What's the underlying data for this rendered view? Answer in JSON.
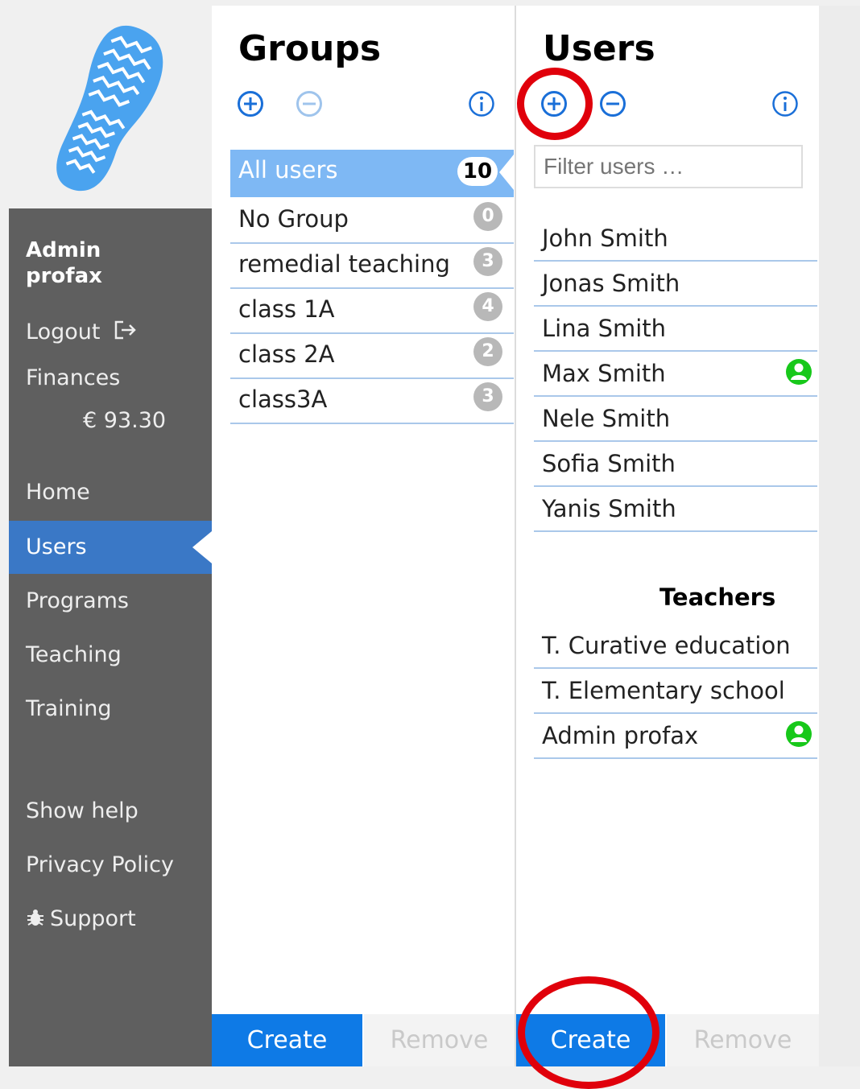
{
  "sidebar": {
    "account": {
      "line1": "Admin",
      "line2": "profax"
    },
    "logout": "Logout",
    "finances": "Finances",
    "balance": "€ 93.30",
    "nav": [
      "Home",
      "Users",
      "Programs",
      "Teaching",
      "Training"
    ],
    "active_nav": "Users",
    "links": [
      "Show help",
      "Privacy Policy",
      "Support"
    ]
  },
  "groups": {
    "title": "Groups",
    "items": [
      {
        "label": "All users",
        "count": "10"
      },
      {
        "label": "No Group",
        "count": "0"
      },
      {
        "label": "remedial teaching",
        "count": "3"
      },
      {
        "label": "class 1A",
        "count": "4"
      },
      {
        "label": "class 2A",
        "count": "2"
      },
      {
        "label": "class3A",
        "count": "3"
      }
    ],
    "create": "Create",
    "remove": "Remove"
  },
  "users": {
    "title": "Users",
    "filter_placeholder": "Filter users …",
    "students": [
      "John Smith",
      "Jonas Smith",
      "Lina Smith",
      "Max Smith",
      "Nele Smith",
      "Sofia Smith",
      "Yanis Smith"
    ],
    "teachers_heading": "Teachers",
    "teachers": [
      "T. Curative education",
      "T. Elementary school",
      "Admin profax"
    ],
    "create": "Create",
    "remove": "Remove"
  },
  "colors": {
    "accent": "#0e7ae6",
    "selected_group": "#7eb8f4",
    "active_nav": "#3a78c6",
    "online": "#17c81a",
    "highlight_ring": "#e0000b"
  },
  "icons": [
    "footprint-logo",
    "logout-icon",
    "bug-icon",
    "add-icon",
    "remove-icon",
    "info-icon",
    "user-online-icon"
  ]
}
